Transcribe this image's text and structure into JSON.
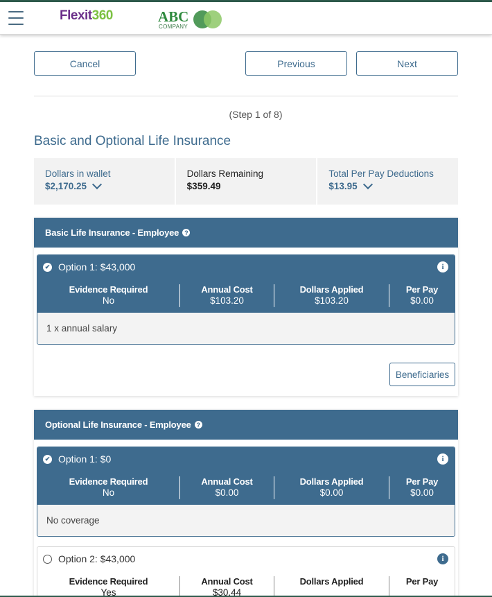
{
  "header": {
    "logo_flexit_part1": "Flexit",
    "logo_flexit_part2": "360",
    "logo_abc": "ABC",
    "logo_abc_sub": "COMPANY"
  },
  "nav": {
    "cancel": "Cancel",
    "previous": "Previous",
    "next": "Next"
  },
  "step": "(Step 1 of 8)",
  "page_title": "Basic and Optional Life Insurance",
  "wallet": {
    "dollars_in_wallet_label": "Dollars in wallet",
    "dollars_in_wallet_value": "$2,170.25",
    "dollars_remaining_label": "Dollars Remaining",
    "dollars_remaining_value": "$359.49",
    "total_per_pay_label": "Total Per Pay Deductions",
    "total_per_pay_value": "$13.95"
  },
  "columns": {
    "evidence": "Evidence Required",
    "annual_cost": "Annual Cost",
    "dollars_applied": "Dollars Applied",
    "per_pay": "Per Pay"
  },
  "basic": {
    "title": "Basic Life Insurance - Employee",
    "option1": {
      "label": "Option 1: $43,000",
      "evidence": "No",
      "annual_cost": "$103.20",
      "dollars_applied": "$103.20",
      "per_pay": "$0.00",
      "description": "1 x annual salary"
    },
    "beneficiaries": "Beneficiaries"
  },
  "optional": {
    "title": "Optional Life Insurance - Employee",
    "option1": {
      "label": "Option 1: $0",
      "evidence": "No",
      "annual_cost": "$0.00",
      "dollars_applied": "$0.00",
      "per_pay": "$0.00",
      "description": "No coverage"
    },
    "option2": {
      "label": "Option 2: $43,000",
      "evidence": "Yes",
      "annual_cost": "$30.44"
    }
  },
  "colors": {
    "primary": "#3e6b8e",
    "brand_green": "#7cc142",
    "brand_purple": "#6b2f8a"
  }
}
